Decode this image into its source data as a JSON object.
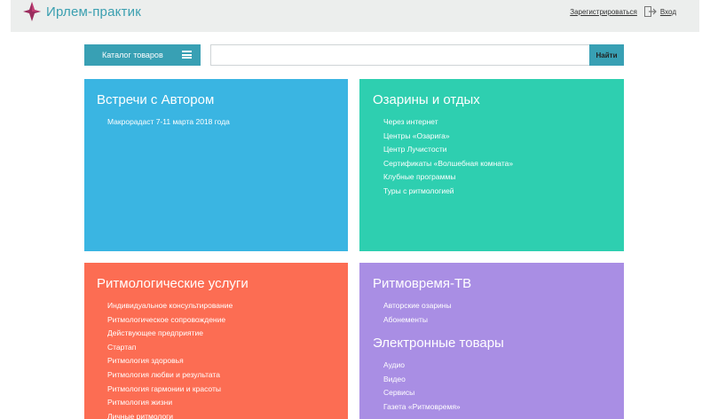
{
  "header": {
    "brand": "Ирлем-практик",
    "register_label": "Зарегистрироваться",
    "login_label": "Вход",
    "logo_colors": [
      "#9b2d5e",
      "#3a9fb0"
    ]
  },
  "toolbar": {
    "catalog_label": "Каталог товаров",
    "search_placeholder": "",
    "search_button_label": "Найти"
  },
  "tiles": [
    {
      "title": "Встречи с Автором",
      "color": "#3ab5e2",
      "items": [
        "Макрорадаст 7-11 марта 2018 года"
      ]
    },
    {
      "title": "Озарины и отдых",
      "color": "#2ecfb0",
      "items": [
        "Через интернет",
        "Центры «Озарига»",
        "Центр Лучистости",
        "Сертификаты «Волшебная комната»",
        "Клубные программы",
        "Туры с ритмологией"
      ]
    },
    {
      "title": "Ритмологические услуги",
      "color": "#fc6d53",
      "items": [
        "Индивидуальное консультирование",
        "Ритмологическое сопровождение",
        "Действующее предприятие",
        "Стартап",
        "Ритмология здоровья",
        "Ритмология любви и результата",
        "Ритмология гармонии и красоты",
        "Ритмология жизни",
        "Личные ритмологи"
      ]
    },
    {
      "title": "Ритмовремя-ТВ",
      "color": "#a98ee4",
      "items": [
        "Авторские озарины",
        "Абонементы"
      ],
      "title2": "Электронные товары",
      "items2": [
        "Аудио",
        "Видео",
        "Сервисы",
        "Газета «Ритмовремя»"
      ]
    }
  ]
}
